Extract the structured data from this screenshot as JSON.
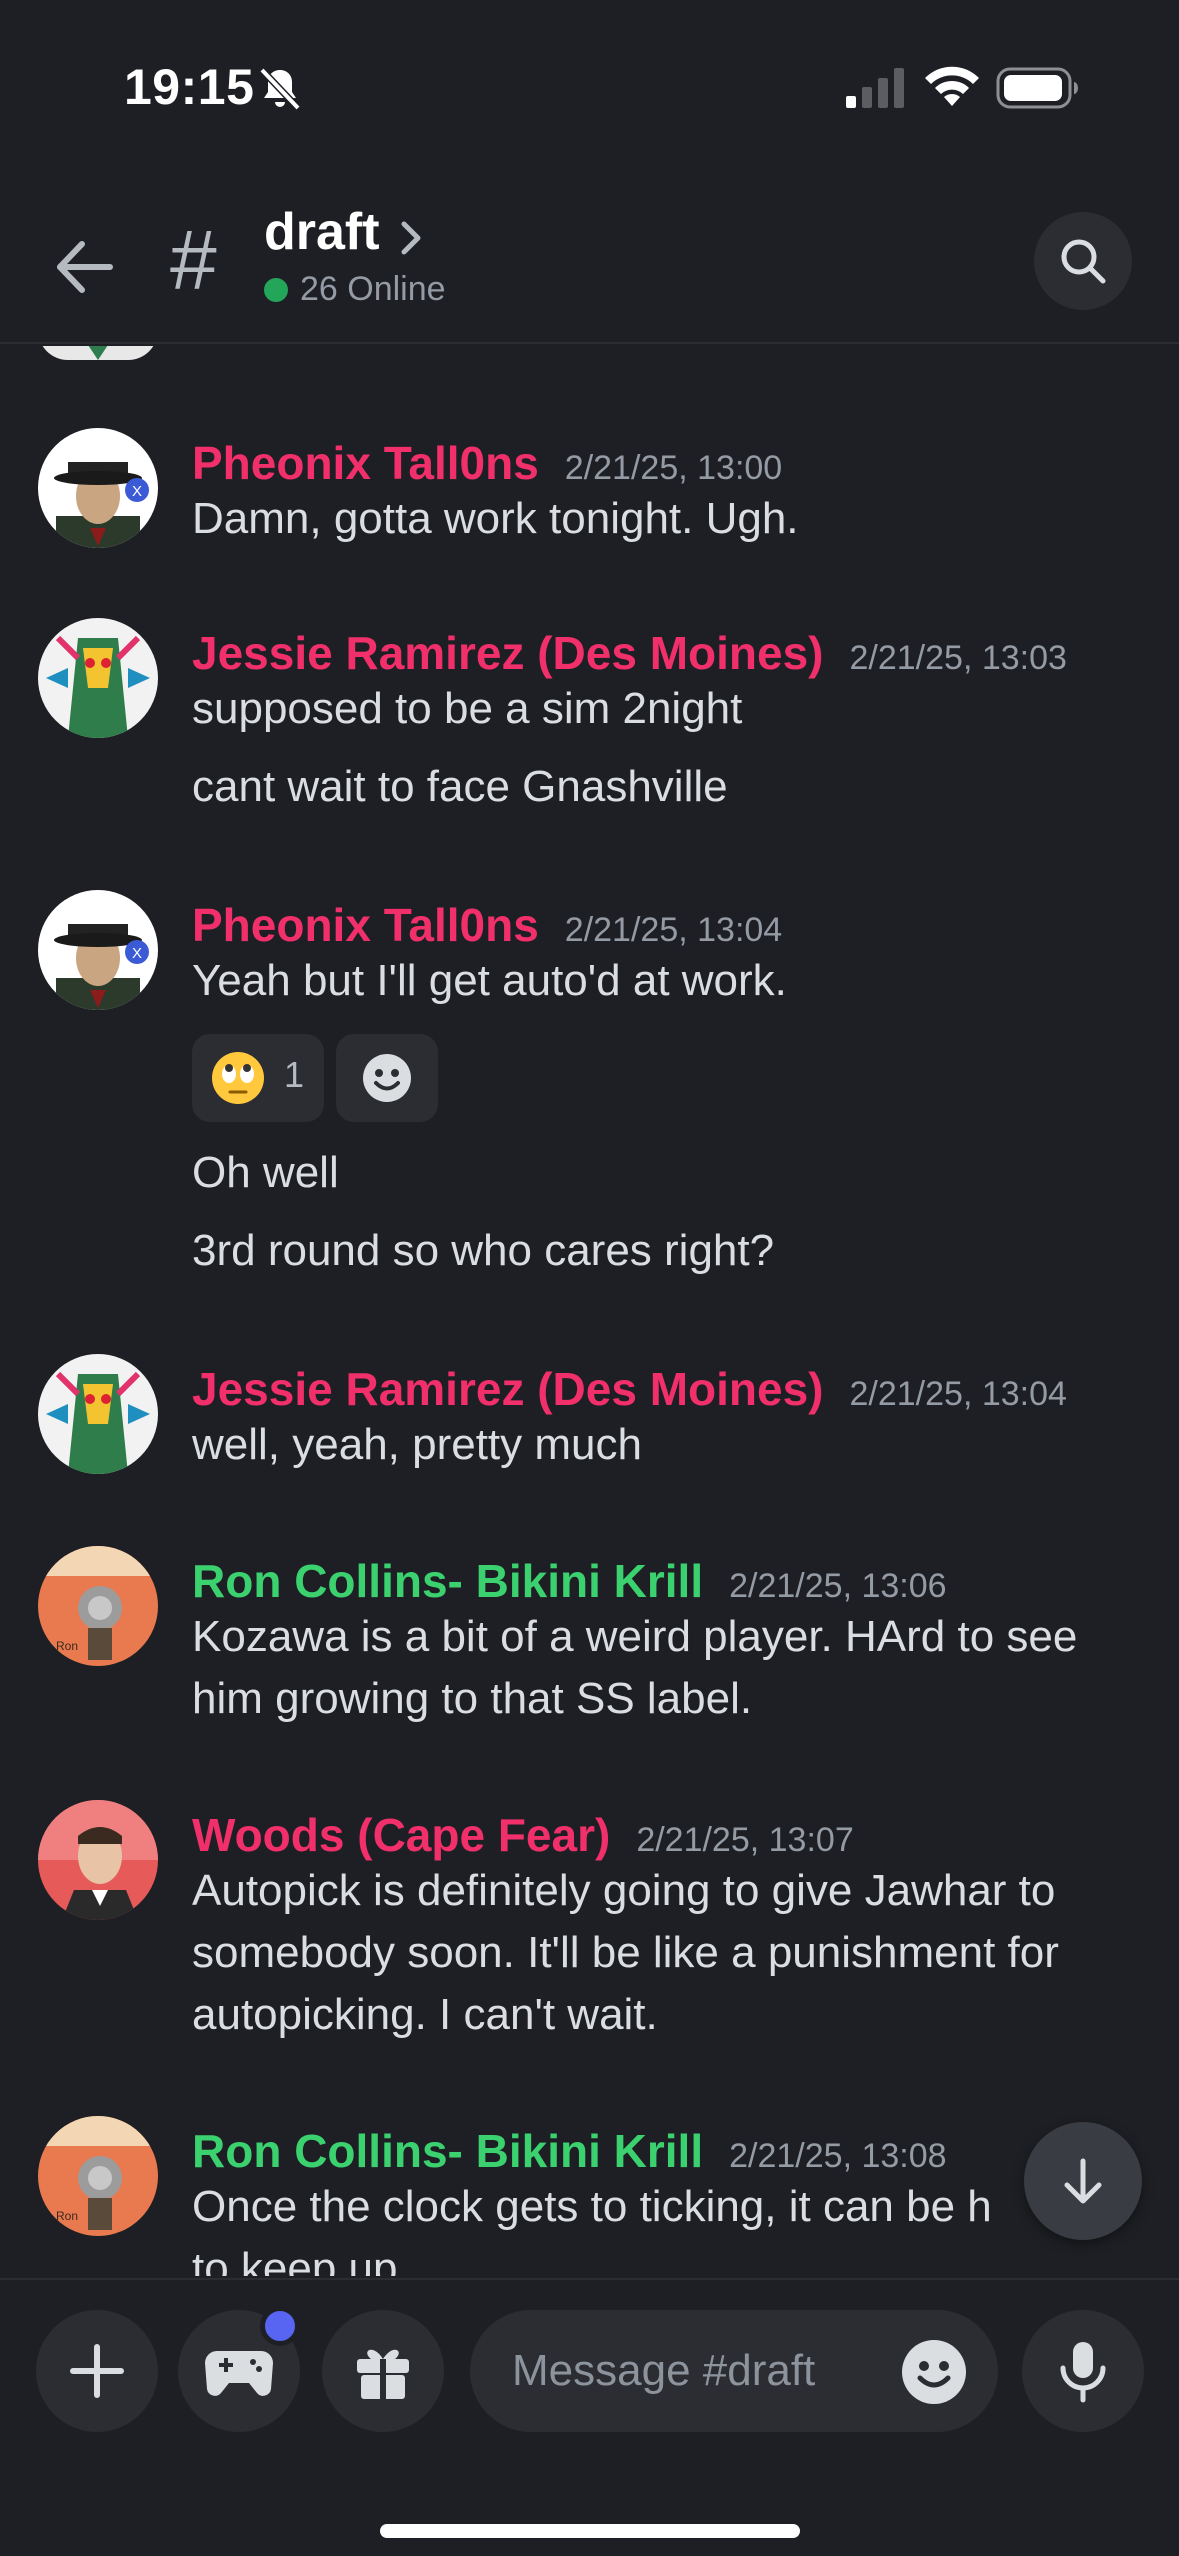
{
  "status_bar": {
    "time": "19:15"
  },
  "header": {
    "channel_hash": "#",
    "channel_name": "draft",
    "online_text": "26 Online"
  },
  "messages": [
    {
      "author": "Pheonix Tall0ns",
      "timestamp": "2/21/25, 13:00",
      "color": "#f1306b",
      "lines": [
        "Damn, gotta work tonight. Ugh."
      ]
    },
    {
      "author": "Jessie Ramirez (Des Moines)",
      "timestamp": "2/21/25, 13:03",
      "color": "#f1306b",
      "lines": [
        "supposed to be a sim 2night",
        "cant wait to face Gnashville"
      ]
    },
    {
      "author": "Pheonix Tall0ns",
      "timestamp": "2/21/25, 13:04",
      "color": "#f1306b",
      "lines": [
        "Yeah but I'll get auto'd at work.",
        "Oh well",
        "3rd round so who cares right?"
      ],
      "reaction": {
        "emoji": "face-with-rolling-eyes",
        "count": "1"
      }
    },
    {
      "author": "Jessie Ramirez (Des Moines)",
      "timestamp": "2/21/25, 13:04",
      "color": "#f1306b",
      "lines": [
        "well, yeah, pretty much"
      ]
    },
    {
      "author": "Ron Collins- Bikini Krill",
      "timestamp": "2/21/25, 13:06",
      "color": "#3bd16f",
      "lines": [
        "Kozawa is a bit of a weird player. HArd to see",
        "him growing to that SS label."
      ]
    },
    {
      "author": "Woods (Cape Fear)",
      "timestamp": "2/21/25, 13:07",
      "color": "#f1306b",
      "lines": [
        "Autopick is definitely going to give Jawhar to",
        "somebody soon. It'll be like a punishment for",
        "autopicking. I can't wait."
      ]
    },
    {
      "author": "Ron Collins- Bikini Krill",
      "timestamp": "2/21/25, 13:08",
      "color": "#3bd16f",
      "lines": [
        "Once the clock gets to ticking, it can be h",
        "to keep up"
      ]
    }
  ],
  "composer": {
    "placeholder": "Message #draft"
  },
  "icons": {
    "back": "arrow-left-icon",
    "search": "search-icon",
    "add": "plus-icon",
    "games": "gamepad-icon",
    "gift": "gift-icon",
    "emoji": "smiley-icon",
    "mic": "microphone-icon",
    "jump": "arrow-down-icon"
  }
}
